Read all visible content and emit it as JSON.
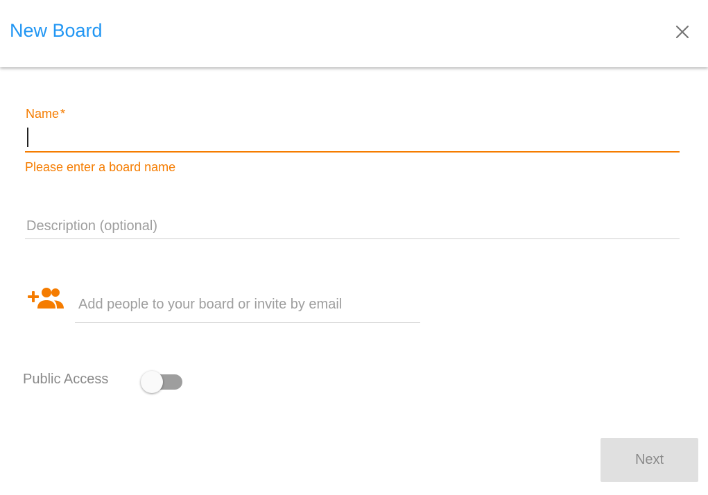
{
  "dialog": {
    "title": "New Board",
    "close_icon": "close-icon"
  },
  "form": {
    "name": {
      "label": "Name",
      "required_marker": "*",
      "value": "",
      "error": "Please enter a board name"
    },
    "description": {
      "placeholder": "Description (optional)",
      "value": ""
    },
    "people": {
      "icon": "add-people-icon",
      "placeholder": "Add people to your board or invite by email",
      "value": ""
    },
    "public_access": {
      "label": "Public Access",
      "enabled": false
    }
  },
  "actions": {
    "next_label": "Next",
    "next_disabled": true
  },
  "colors": {
    "title": "#2196f3",
    "accent_error": "#f57c00",
    "toggle_track": "#9e9e9e",
    "button_disabled_bg": "#e0e0e0"
  }
}
